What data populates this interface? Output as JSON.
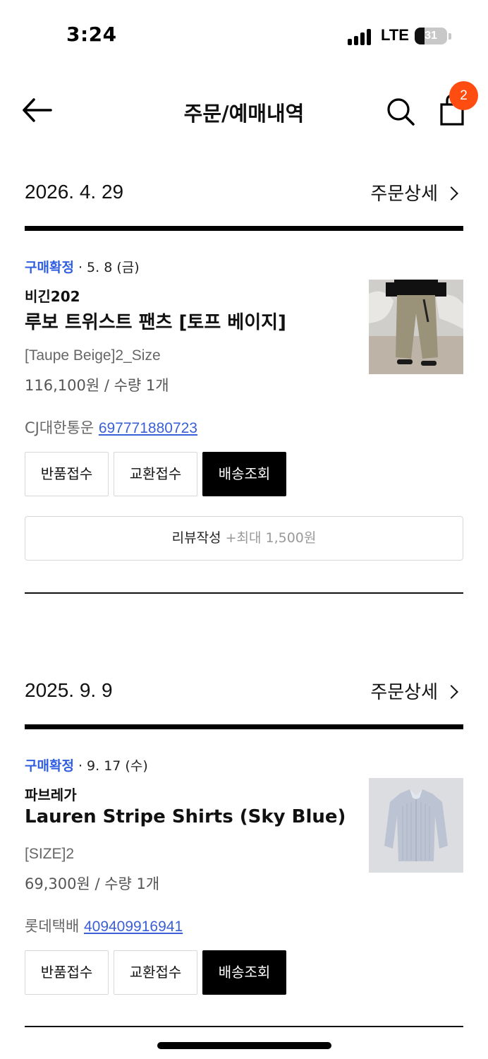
{
  "status_bar": {
    "time": "3:24",
    "network": "LTE",
    "battery": "31",
    "battery_level": 0.31
  },
  "header": {
    "title": "주문/예매내역",
    "back_icon": "arrow-left-icon",
    "search_icon": "search-icon",
    "cart_icon": "shopping-bag-icon",
    "cart_badge": "2",
    "badge_color": "#ff4d12"
  },
  "orders": [
    {
      "date": "2026. 4. 29",
      "detail_label": "주문상세",
      "status": "구매확정",
      "status_date": " · 5. 8 (금)",
      "brand": "비긴202",
      "product_name": "루보 트위스트 팬츠 [토프 베이지]",
      "option": "[Taupe Beige]2_Size",
      "price_qty": "116,100원 / 수량 1개",
      "carrier": "CJ대한통운",
      "tracking_number": "697771880723",
      "buttons": [
        "반품접수",
        "교환접수",
        "배송조회"
      ],
      "review_label": "리뷰작성",
      "review_bonus": "+최대 1,500원"
    },
    {
      "date": "2025. 9. 9",
      "detail_label": "주문상세",
      "status": "구매확정",
      "status_date": " · 9. 17 (수)",
      "brand": "파브레가",
      "product_name": "Lauren Stripe Shirts (Sky Blue)",
      "option": "[SIZE]2",
      "price_qty": "69,300원 / 수량 1개",
      "carrier": "롯데택배",
      "tracking_number": "409409916941",
      "buttons": [
        "반품접수",
        "교환접수",
        "배송조회"
      ]
    }
  ],
  "colors": {
    "status_confirmed": "#2f5ee0",
    "tracking_link": "#3a5fd6",
    "primary_button": "#000000"
  }
}
